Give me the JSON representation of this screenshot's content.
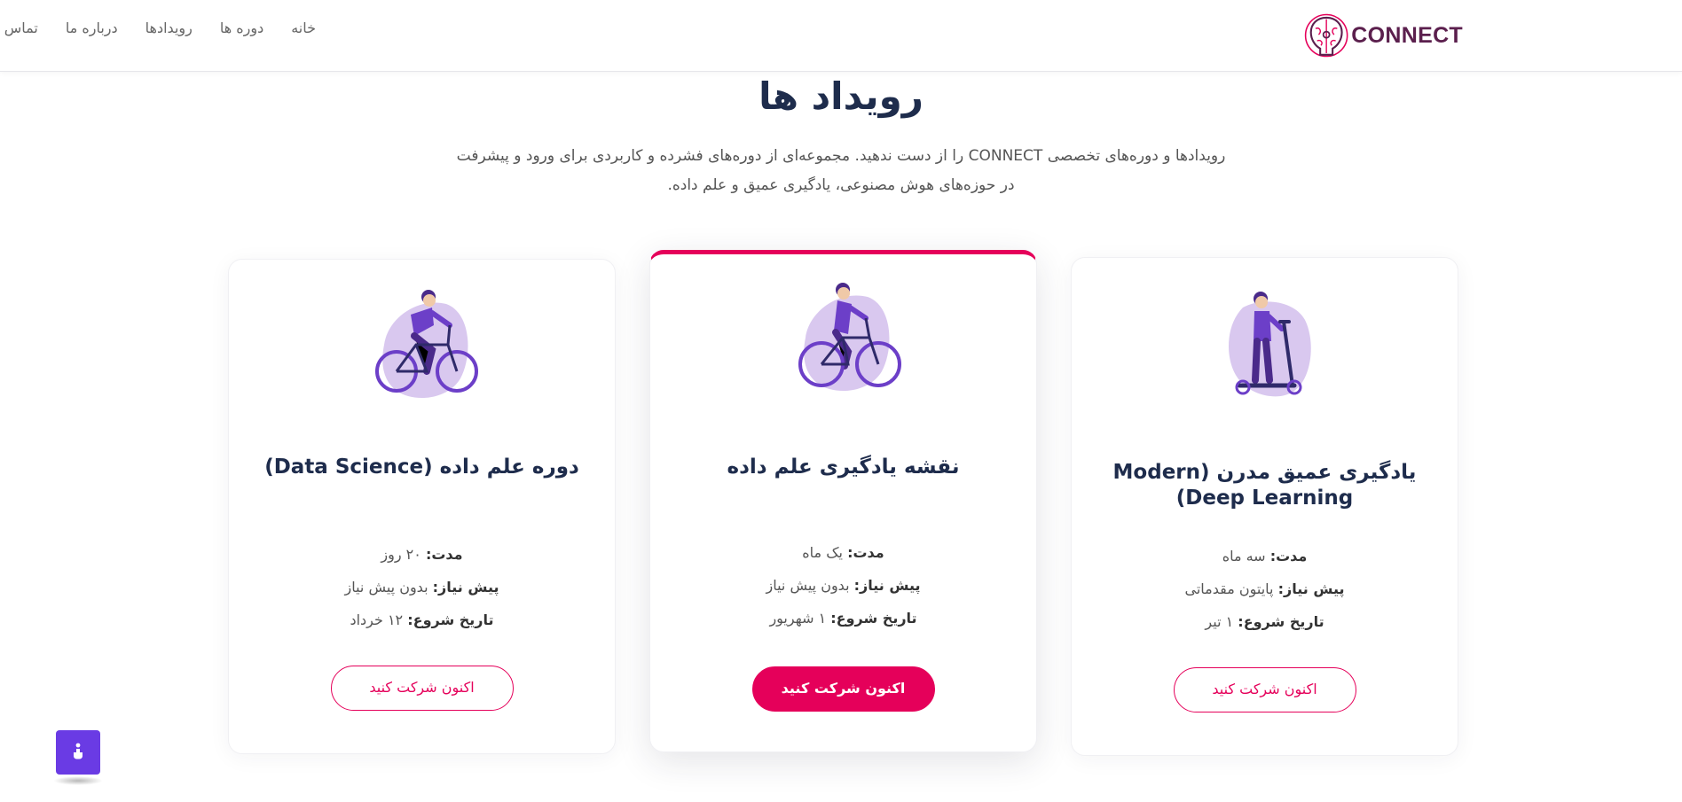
{
  "header": {
    "logo_text": "CONNECT",
    "nav": [
      "خانه",
      "دوره ها",
      "رویدادها",
      "درباره ما",
      "تماس با ما"
    ]
  },
  "section": {
    "title": "رویداد ها",
    "description_line1": "رویدادها و دوره‌های تخصصی CONNECT را از دست ندهید. مجموعه‌ای از دوره‌های فشرده و کاربردی برای ورود و پیشرفت",
    "description_line2": "در حوزه‌های هوش مصنوعی، یادگیری عمیق و علم داده."
  },
  "labels": {
    "duration": "مدت:",
    "prerequisite": "پیش نیاز:",
    "start_date": "تاریخ شروع:"
  },
  "cards": [
    {
      "title": "یادگیری عمیق مدرن (Modern Deep Learning)",
      "duration": "سه ماه",
      "prerequisite": "پایتون مقدماتی",
      "start_date": "۱ تیر",
      "button": "اکنون شرکت کنید",
      "illustration": "scooter-rider-icon"
    },
    {
      "title": "نقشه یادگیری علم داده",
      "duration": "یک ماه",
      "prerequisite": "بدون پیش نیاز",
      "start_date": "۱ شهریور",
      "button": "اکنون شرکت کنید",
      "illustration": "bicycle-rider-icon",
      "featured": true
    },
    {
      "title": "دوره علم داده (Data Science)",
      "duration": "۲۰ روز",
      "prerequisite": "بدون پیش نیاز",
      "start_date": "۱۲ خرداد",
      "button": "اکنون شرکت کنید",
      "illustration": "bicycle-rider-icon"
    }
  ],
  "colors": {
    "accent": "#e5005a",
    "heading": "#1e2c4c",
    "illustration_purple": "#6c3fc8",
    "illustration_blob": "#d9c8ef",
    "a11y_button": "#6a3be4"
  },
  "widgets": {
    "accessibility_icon": "accessibility-icon"
  }
}
